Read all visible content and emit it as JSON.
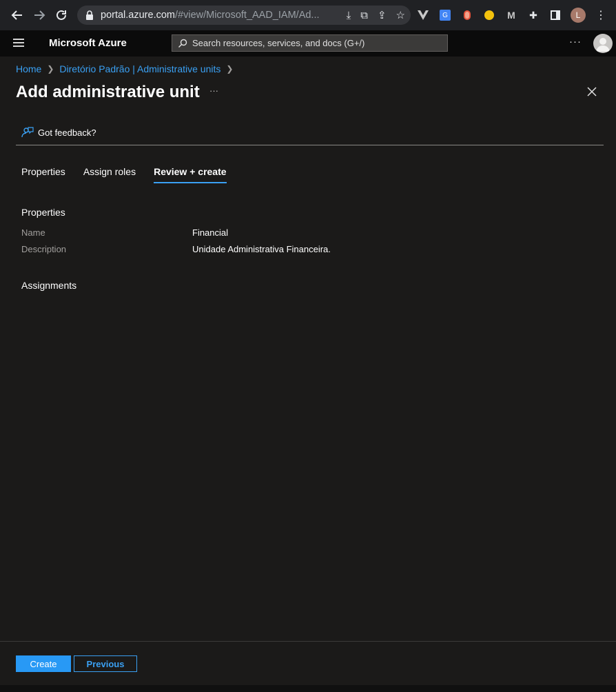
{
  "browser": {
    "url_host": "portal.azure.com",
    "url_path": "/#view/Microsoft_AAD_IAM/Ad...",
    "profile_initial": "L"
  },
  "header": {
    "brand": "Microsoft Azure",
    "search_placeholder": "Search resources, services, and docs (G+/)",
    "more": "···"
  },
  "breadcrumb": {
    "home": "Home",
    "parent": "Diretório Padrão | Administrative units"
  },
  "page": {
    "title": "Add administrative unit",
    "more": "···",
    "feedback": "Got feedback?"
  },
  "tabs": [
    "Properties",
    "Assign roles",
    "Review + create"
  ],
  "active_tab": "Review + create",
  "review": {
    "properties_heading": "Properties",
    "name_label": "Name",
    "name_value": "Financial",
    "description_label": "Description",
    "description_value": "Unidade Administrativa Financeira.",
    "assignments_heading": "Assignments"
  },
  "footer": {
    "create": "Create",
    "previous": "Previous"
  },
  "colors": {
    "accent": "#3aa0f3",
    "primary_button": "#2899f5",
    "background": "#1b1a19"
  }
}
